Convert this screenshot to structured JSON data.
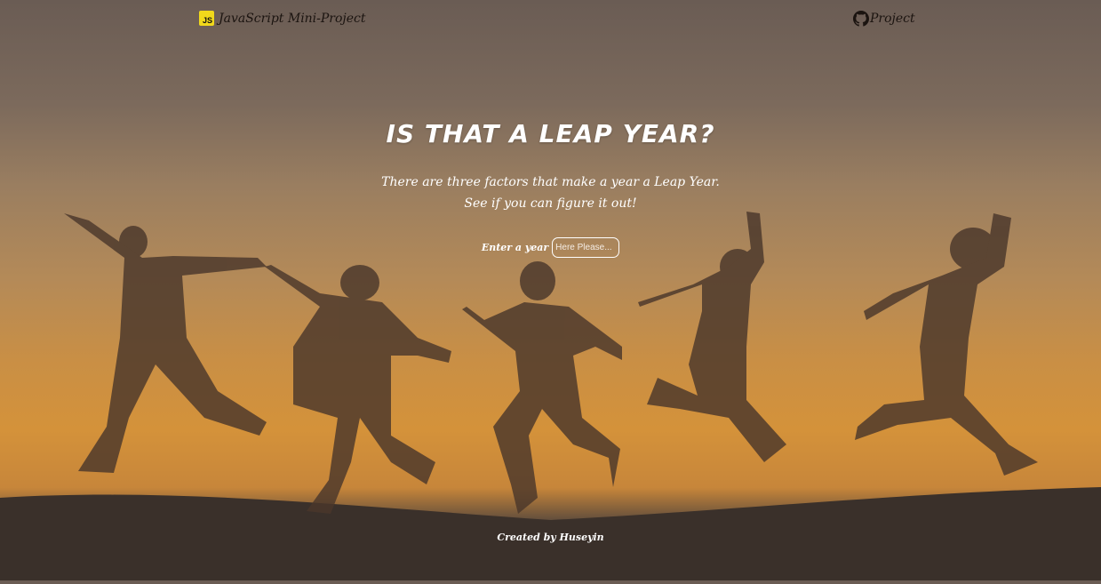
{
  "header": {
    "brand_badge": "JS",
    "brand_label": "JavaScript Mini-Project",
    "project_label": "Project",
    "project_icon": "github-icon"
  },
  "hero": {
    "title": "IS THAT A LEAP YEAR?",
    "subtitle_line1": "There are three factors that make a year a Leap Year.",
    "subtitle_line2": "See if you can figure it out!",
    "input_label": "Enter a year",
    "input_placeholder": "Here Please...",
    "input_value": ""
  },
  "footer": {
    "credit": "Created by Huseyin"
  },
  "colors": {
    "sky_top": "#6a5c54",
    "sky_sunset": "#d4923a",
    "silhouette": "#4a372b",
    "text": "#ffffff",
    "js_badge": "#f1d91b"
  }
}
